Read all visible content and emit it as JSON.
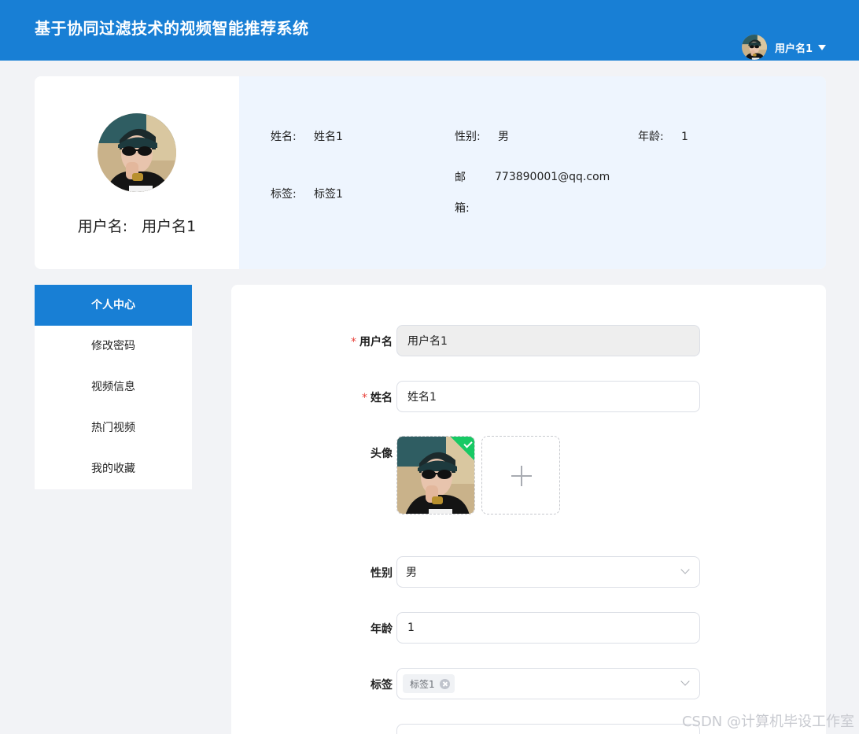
{
  "header": {
    "app_title": "基于协同过滤技术的视频智能推荐系统",
    "user_name": "用户名1"
  },
  "profile": {
    "username_label": "用户名:",
    "username": "用户名1",
    "name_label": "姓名:",
    "name": "姓名1",
    "gender_label": "性别:",
    "gender": "男",
    "age_label": "年龄:",
    "age": "1",
    "tag_label": "标签:",
    "tag": "标签1",
    "email_label": "邮箱:",
    "email": "773890001@qq.com"
  },
  "menu": {
    "items": [
      {
        "label": "个人中心"
      },
      {
        "label": "修改密码"
      },
      {
        "label": "视频信息"
      },
      {
        "label": "热门视频"
      },
      {
        "label": "我的收藏"
      }
    ]
  },
  "form": {
    "username_label": "用户名",
    "username_value": "用户名1",
    "name_label": "姓名",
    "name_value": "姓名1",
    "avatar_label": "头像",
    "gender_label": "性别",
    "gender_value": "男",
    "age_label": "年龄",
    "age_value": "1",
    "tags_label": "标签",
    "tags": [
      "标签1"
    ]
  },
  "watermark": "CSDN @计算机毕设工作室",
  "colors": {
    "primary": "#187fd5",
    "info_bg": "#eef5fe",
    "required": "#e8413a",
    "upload_success": "#17c964"
  }
}
